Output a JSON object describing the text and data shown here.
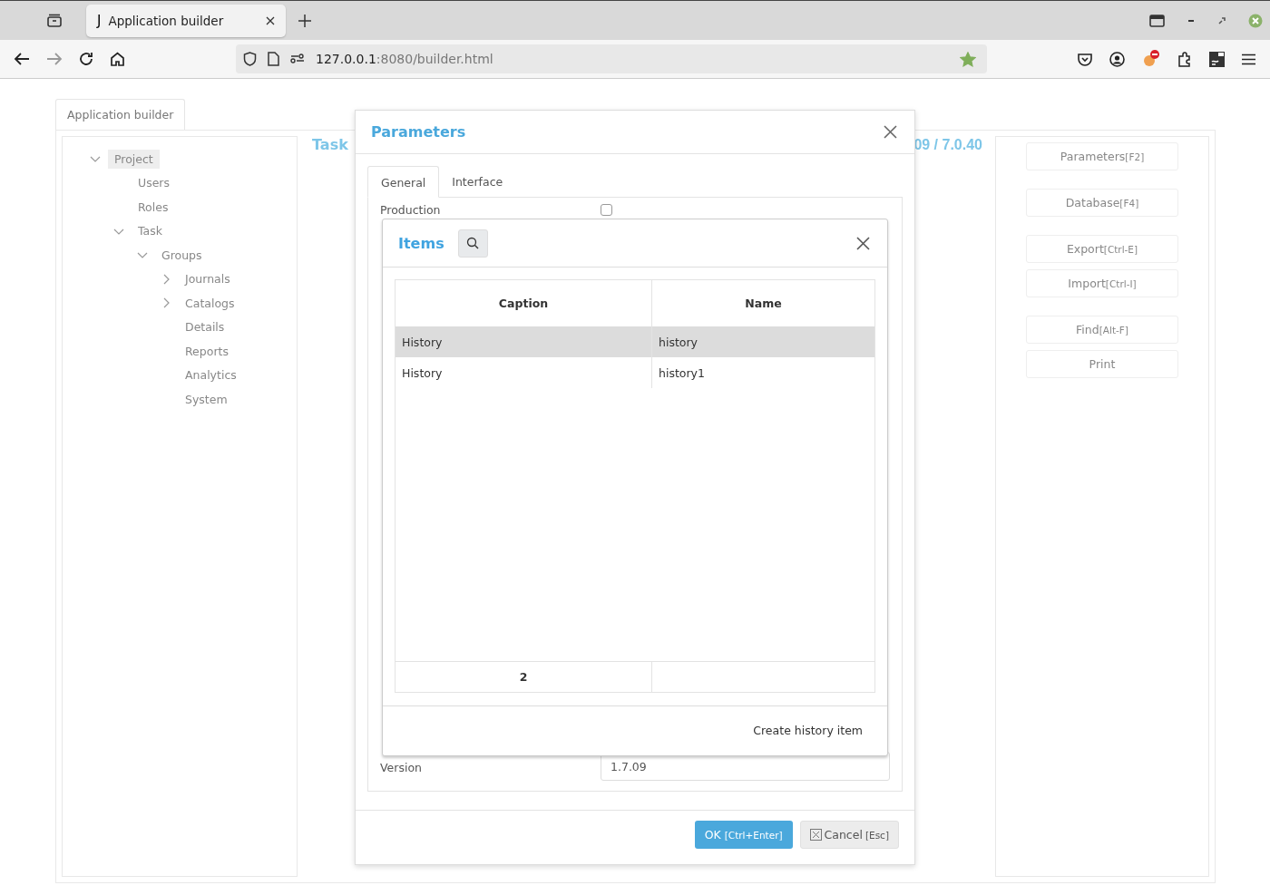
{
  "browser": {
    "tab_icon": "J",
    "tab_title": "Application builder",
    "url_host": "127.0.0.1",
    "url_path": ":8080/builder.html",
    "bookmarked": true
  },
  "app": {
    "tab": "Application builder",
    "heading": "Task",
    "version_text": "09 / 7.0.40",
    "tree": [
      {
        "label": "Project",
        "kind": "branch",
        "expanded": true,
        "selected": true,
        "children": [
          {
            "label": "Users",
            "kind": "leaf",
            "selected": false
          },
          {
            "label": "Roles",
            "kind": "leaf",
            "selected": false
          },
          {
            "label": "Task",
            "kind": "branch",
            "expanded": true,
            "selected": false,
            "children": [
              {
                "label": "Groups",
                "kind": "branch",
                "expanded": true,
                "selected": false,
                "children": [
                  {
                    "label": "Journals",
                    "kind": "branch",
                    "expanded": false,
                    "selected": false
                  },
                  {
                    "label": "Catalogs",
                    "kind": "branch",
                    "expanded": false,
                    "selected": false
                  },
                  {
                    "label": "Details",
                    "kind": "leaf",
                    "selected": false
                  },
                  {
                    "label": "Reports",
                    "kind": "leaf",
                    "selected": false
                  },
                  {
                    "label": "Analytics",
                    "kind": "leaf",
                    "selected": false
                  },
                  {
                    "label": "System",
                    "kind": "leaf",
                    "selected": false
                  }
                ]
              }
            ]
          }
        ]
      }
    ],
    "action_groups": [
      [
        {
          "label": "Parameters",
          "shortcut": "[F2]"
        }
      ],
      [
        {
          "label": "Database",
          "shortcut": "[F4]"
        }
      ],
      [
        {
          "label": "Export",
          "shortcut": "[Ctrl-E]"
        },
        {
          "label": "Import",
          "shortcut": "[Ctrl-I]"
        }
      ],
      [
        {
          "label": "Find",
          "shortcut": "[Alt-F]"
        },
        {
          "label": "Print"
        }
      ]
    ]
  },
  "parameters_dialog": {
    "title": "Parameters",
    "tabs": [
      {
        "label": "General",
        "selected": true
      },
      {
        "label": "Interface",
        "selected": false
      }
    ],
    "production": {
      "label": "Production",
      "checked": false
    },
    "version": {
      "label": "Version",
      "value": "1.7.09"
    },
    "ok": {
      "label": "OK",
      "shortcut": "[Ctrl+Enter]"
    },
    "cancel": {
      "label": "Cancel",
      "shortcut": "[Esc]"
    }
  },
  "items_dialog": {
    "title": "Items",
    "columns": [
      "Caption",
      "Name"
    ],
    "rows": [
      {
        "cells": [
          "History",
          "history"
        ],
        "selected": true
      },
      {
        "cells": [
          "History",
          "history1"
        ],
        "selected": false
      }
    ],
    "count": "2",
    "create_button": "Create history item"
  }
}
